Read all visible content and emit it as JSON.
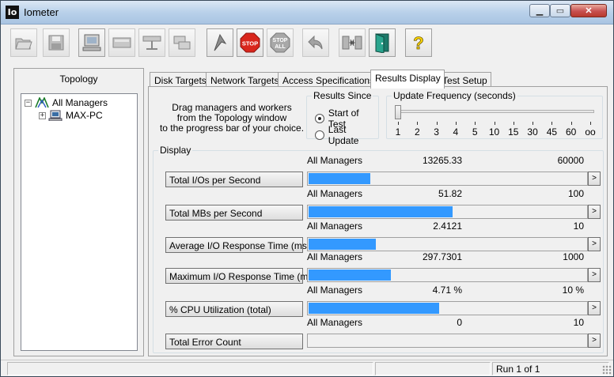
{
  "window": {
    "title": "Iometer",
    "icon_text": "Io"
  },
  "toolbar": {
    "buttons": [
      {
        "name": "open-config-button",
        "icon": "folder-open-icon"
      },
      {
        "name": "save-config-button",
        "icon": "floppy-disk-icon"
      },
      {
        "name": "start-new-manager-button",
        "icon": "computer-icon"
      },
      {
        "name": "start-disk-worker-button",
        "icon": "disk-worker-icon"
      },
      {
        "name": "start-network-worker-button",
        "icon": "network-worker-icon"
      },
      {
        "name": "duplicate-worker-button",
        "icon": "duplicate-worker-icon"
      },
      {
        "name": "start-tests-button",
        "icon": "green-flag-icon"
      },
      {
        "name": "stop-button",
        "icon": "stop-sign-icon",
        "label": "STOP"
      },
      {
        "name": "stop-all-button",
        "icon": "stop-all-sign-icon",
        "label": "STOP\nALL"
      },
      {
        "name": "reset-workers-button",
        "icon": "undo-arrow-icon"
      },
      {
        "name": "disconnect-button",
        "icon": "disconnect-icon"
      },
      {
        "name": "exit-button",
        "icon": "exit-door-icon"
      },
      {
        "name": "about-button",
        "icon": "question-mark-icon",
        "label": "?"
      }
    ]
  },
  "topology": {
    "title": "Topology",
    "root": "All Managers",
    "child": "MAX-PC"
  },
  "tabs": [
    {
      "label": "Disk Targets",
      "active": false
    },
    {
      "label": "Network Targets",
      "active": false
    },
    {
      "label": "Access Specifications",
      "active": false
    },
    {
      "label": "Results Display",
      "active": true
    },
    {
      "label": "Test Setup",
      "active": false
    }
  ],
  "results_display": {
    "drag_text_1": "Drag managers and workers",
    "drag_text_2": "from the Topology window",
    "drag_text_3": "to the progress bar of your choice.",
    "results_since": {
      "label": "Results Since",
      "options": [
        {
          "label": "Start of Test",
          "checked": true
        },
        {
          "label": "Last Update",
          "checked": false
        }
      ]
    },
    "update_frequency": {
      "label": "Update Frequency (seconds)",
      "ticks": [
        "1",
        "2",
        "3",
        "4",
        "5",
        "10",
        "15",
        "30",
        "45",
        "60",
        "oo"
      ],
      "selected_index": 0
    },
    "display": {
      "label": "Display",
      "metrics": [
        {
          "button": "Total I/Os per Second",
          "manager": "All Managers",
          "value": "13265.33",
          "max": "60000",
          "fraction": 0.221
        },
        {
          "button": "Total MBs per Second",
          "manager": "All Managers",
          "value": "51.82",
          "max": "100",
          "fraction": 0.5182
        },
        {
          "button": "Average I/O Response Time (ms)",
          "manager": "All Managers",
          "value": "2.4121",
          "max": "10",
          "fraction": 0.2412
        },
        {
          "button": "Maximum I/O Response Time (ms)",
          "manager": "All Managers",
          "value": "297.7301",
          "max": "1000",
          "fraction": 0.2977
        },
        {
          "button": "% CPU Utilization (total)",
          "manager": "All Managers",
          "value": "4.71 %",
          "max": "10 %",
          "fraction": 0.471
        },
        {
          "button": "Total Error Count",
          "manager": "All Managers",
          "value": "0",
          "max": "10",
          "fraction": 0
        }
      ],
      "more_label": ">"
    }
  },
  "statusbar": {
    "text": "Run 1 of 1"
  }
}
